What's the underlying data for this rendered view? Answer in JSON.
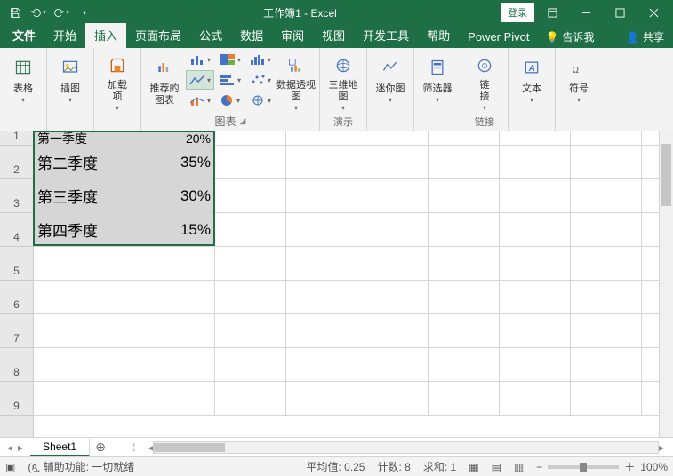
{
  "title": "工作簿1 - Excel",
  "login": "登录",
  "tabs": {
    "file": "文件",
    "home": "开始",
    "insert": "插入",
    "layout": "页面布局",
    "formulas": "公式",
    "data": "数据",
    "review": "审阅",
    "view": "视图",
    "dev": "开发工具",
    "help": "帮助",
    "pivot": "Power Pivot",
    "tell": "告诉我",
    "share": "共享"
  },
  "ribbon": {
    "tables": {
      "table": "表格"
    },
    "illustrations": {
      "label": "插图"
    },
    "addins": {
      "label": "加载\n项"
    },
    "charts": {
      "recommend": "推荐的\n图表",
      "group": "图表",
      "pivot_chart": "数据透视图"
    },
    "tours": {
      "map": "三维地\n图",
      "group": "演示"
    },
    "sparklines": {
      "label": "迷你图"
    },
    "filters": {
      "label": "筛选器"
    },
    "links": {
      "label": "链\n接",
      "group": "链接"
    },
    "text": {
      "label": "文本"
    },
    "symbols": {
      "label": "符号"
    }
  },
  "sheet": {
    "rows": [
      {
        "n": 1,
        "A": "第一季度",
        "B": "20%"
      },
      {
        "n": 2,
        "A": "第二季度",
        "B": "35%"
      },
      {
        "n": 3,
        "A": "第三季度",
        "B": "30%"
      },
      {
        "n": 4,
        "A": "第四季度",
        "B": "15%"
      },
      {
        "n": 5,
        "A": "",
        "B": ""
      },
      {
        "n": 6,
        "A": "",
        "B": ""
      },
      {
        "n": 7,
        "A": "",
        "B": ""
      },
      {
        "n": 8,
        "A": "",
        "B": ""
      },
      {
        "n": 9,
        "A": "",
        "B": ""
      }
    ],
    "tab": "Sheet1"
  },
  "status": {
    "acc": "辅助功能: 一切就绪",
    "avg_l": "平均值:",
    "avg": "0.25",
    "count_l": "计数:",
    "count": "8",
    "sum_l": "求和:",
    "sum": "1",
    "zoom": "100%"
  },
  "chart_data": {
    "type": "pie",
    "categories": [
      "第一季度",
      "第二季度",
      "第三季度",
      "第四季度"
    ],
    "values": [
      0.2,
      0.35,
      0.3,
      0.15
    ]
  }
}
